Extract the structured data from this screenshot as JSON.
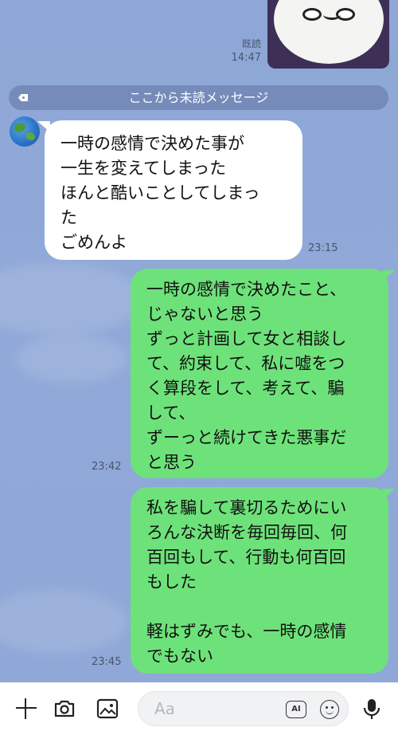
{
  "read_receipt": {
    "status": "既読",
    "time": "14:47"
  },
  "unread_divider": {
    "label": "ここから未読メッセージ"
  },
  "messages": [
    {
      "lines": [
        "一時の感情で決めた事が",
        "一生を変えてしまった",
        "ほんと酷いことしてしまっ",
        "た",
        "ごめんよ"
      ],
      "time": "23:15"
    },
    {
      "lines": [
        "一時の感情で決めたこと、",
        "じゃないと思う",
        "ずっと計画して女と相談し",
        "て、約束して、私に嘘をつ",
        "く算段をして、考えて、騙",
        "して、",
        "ずーっと続けてきた悪事だ",
        "と思う"
      ],
      "time": "23:42"
    },
    {
      "lines": [
        "私を騙して裏切るためにい",
        "ろんな決断を毎回毎回、何",
        "百回もして、行動も何百回",
        "もした",
        "",
        "軽はずみでも、一時の感情",
        "でもない"
      ],
      "time": "23:45"
    }
  ],
  "composer": {
    "placeholder": "Aa",
    "ai_label": "AI"
  },
  "icons": [
    "plus-icon",
    "camera-icon",
    "image-icon",
    "ai-icon",
    "emoji-icon",
    "microphone-icon"
  ],
  "colors": {
    "background": "#8fa8d7",
    "outgoing_bubble": "#6ee27a",
    "incoming_bubble": "#ffffff",
    "sticker_bg": "#3e2f57"
  }
}
